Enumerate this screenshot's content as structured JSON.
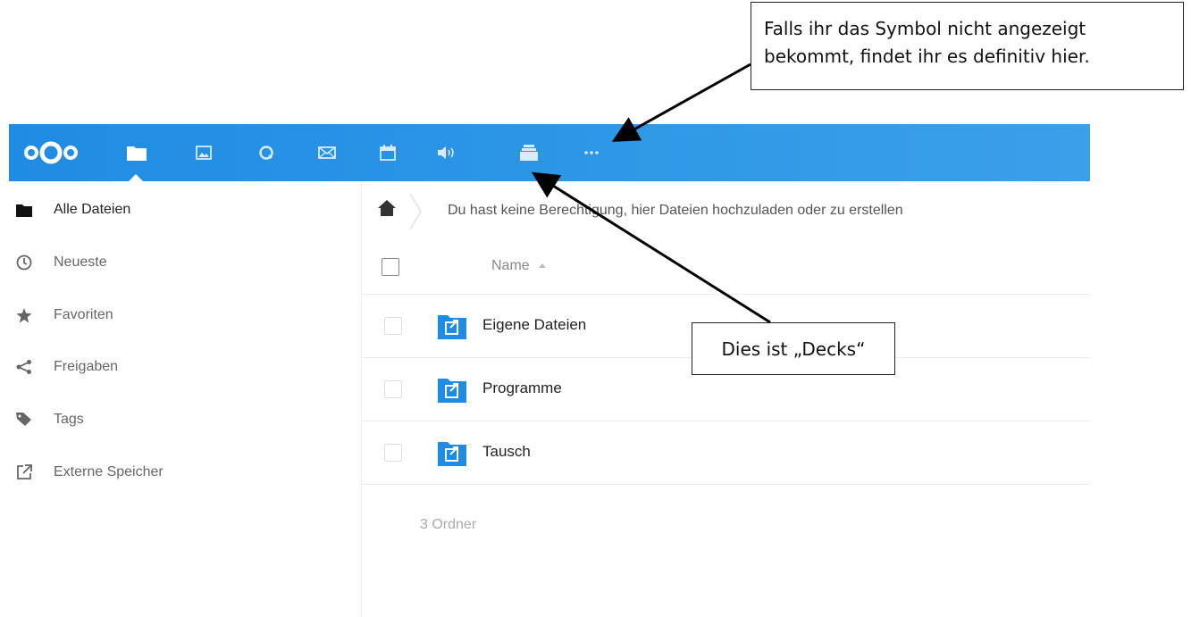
{
  "topbar": {
    "apps": [
      {
        "name": "files",
        "icon": "folder-icon",
        "active": true
      },
      {
        "name": "photos",
        "icon": "image-icon"
      },
      {
        "name": "activity",
        "icon": "search-circle-icon"
      },
      {
        "name": "mail",
        "icon": "mail-icon"
      },
      {
        "name": "calendar",
        "icon": "calendar-icon"
      },
      {
        "name": "audio",
        "icon": "speaker-icon"
      },
      {
        "name": "deck",
        "icon": "deck-icon"
      },
      {
        "name": "more",
        "icon": "more-icon"
      }
    ],
    "color_start": "#1f8ce3",
    "color_end": "#3aa0ea"
  },
  "sidebar": {
    "items": [
      {
        "label": "Alle Dateien",
        "icon": "folder-icon",
        "active": true
      },
      {
        "label": "Neueste",
        "icon": "clock-icon"
      },
      {
        "label": "Favoriten",
        "icon": "star-icon"
      },
      {
        "label": "Freigaben",
        "icon": "share-icon"
      },
      {
        "label": "Tags",
        "icon": "tag-icon"
      },
      {
        "label": "Externe Speicher",
        "icon": "external-link-icon"
      }
    ]
  },
  "main": {
    "permission_message": "Du hast keine Berechtigung, hier Dateien hochzuladen oder zu erstellen",
    "column_name": "Name",
    "files": [
      {
        "name": "Eigene Dateien",
        "icon": "external-folder-icon"
      },
      {
        "name": "Programme",
        "icon": "external-folder-icon"
      },
      {
        "name": "Tausch",
        "icon": "external-folder-icon"
      }
    ],
    "summary": "3 Ordner"
  },
  "annotations": {
    "top_callout": "Falls ihr das Symbol nicht angezeigt bekommt, findet ihr es definitiv hier.",
    "decks_callout": "Dies ist „Decks“"
  }
}
